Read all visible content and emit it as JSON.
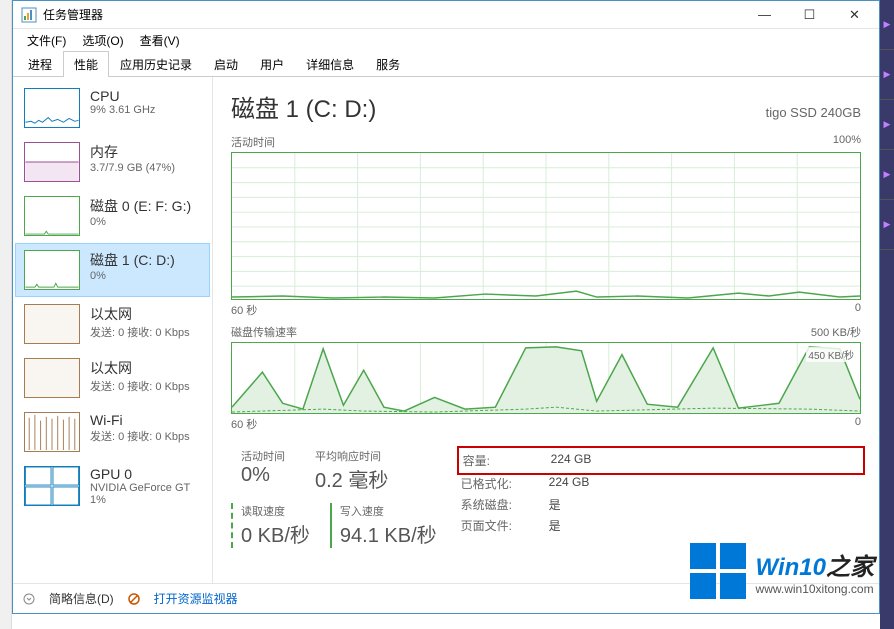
{
  "window": {
    "title": "任务管理器",
    "menu": {
      "file": "文件(F)",
      "options": "选项(O)",
      "view": "查看(V)"
    },
    "tabs": {
      "processes": "进程",
      "performance": "性能",
      "apphistory": "应用历史记录",
      "startup": "启动",
      "users": "用户",
      "details": "详细信息",
      "services": "服务"
    },
    "controls": {
      "min": "—",
      "max": "☐",
      "close": "✕"
    }
  },
  "sidebar": {
    "cpu": {
      "title": "CPU",
      "sub": "9% 3.61 GHz"
    },
    "mem": {
      "title": "内存",
      "sub": "3.7/7.9 GB (47%)"
    },
    "disk0": {
      "title": "磁盘 0 (E: F: G:)",
      "sub": "0%"
    },
    "disk1": {
      "title": "磁盘 1 (C: D:)",
      "sub": "0%"
    },
    "eth0": {
      "title": "以太网",
      "sub": "发送: 0 接收: 0 Kbps"
    },
    "eth1": {
      "title": "以太网",
      "sub": "发送: 0 接收: 0 Kbps"
    },
    "wifi": {
      "title": "Wi-Fi",
      "sub": "发送: 0 接收: 0 Kbps"
    },
    "gpu0": {
      "title": "GPU 0",
      "sub": "NVIDIA GeForce GT",
      "sub2": "1%"
    }
  },
  "main": {
    "title": "磁盘 1 (C: D:)",
    "model": "tigo SSD 240GB",
    "chart1": {
      "label_tl": "活动时间",
      "label_tr": "100%",
      "xl": "60 秒",
      "xr": "0"
    },
    "chart2": {
      "label_tl": "磁盘传输速率",
      "label_tr": "500 KB/秒",
      "inset": "450 KB/秒",
      "xl": "60 秒",
      "xr": "0"
    },
    "stats": {
      "active_label": "活动时间",
      "active_value": "0%",
      "avg_label": "平均响应时间",
      "avg_value": "0.2 毫秒",
      "read_label": "读取速度",
      "read_value": "0 KB/秒",
      "write_label": "写入速度",
      "write_value": "94.1 KB/秒"
    },
    "props": {
      "capacity_k": "容量:",
      "capacity_v": "224 GB",
      "formatted_k": "已格式化:",
      "formatted_v": "224 GB",
      "system_k": "系统磁盘:",
      "system_v": "是",
      "pagefile_k": "页面文件:",
      "pagefile_v": "是"
    }
  },
  "statusbar": {
    "fewer": "简略信息(D)",
    "resmon": "打开资源监视器"
  },
  "watermark": {
    "title_a": "Win10",
    "title_b": "之家",
    "url": "www.win10xitong.com"
  },
  "chart_data": [
    {
      "type": "line",
      "title": "活动时间",
      "xlabel": "秒",
      "ylabel": "%",
      "xlim": [
        0,
        60
      ],
      "ylim": [
        0,
        100
      ],
      "x": [
        60,
        55,
        50,
        45,
        40,
        35,
        30,
        25,
        20,
        15,
        10,
        5,
        0
      ],
      "values": [
        1,
        2,
        0,
        1,
        0,
        3,
        2,
        1,
        4,
        2,
        0,
        2,
        1
      ]
    },
    {
      "type": "line",
      "title": "磁盘传输速率",
      "xlabel": "秒",
      "ylabel": "KB/秒",
      "xlim": [
        0,
        60
      ],
      "ylim": [
        0,
        500
      ],
      "x": [
        60,
        57,
        54,
        51,
        48,
        45,
        42,
        39,
        36,
        33,
        30,
        27,
        24,
        21,
        18,
        15,
        12,
        9,
        6,
        3,
        0
      ],
      "series": [
        {
          "name": "写入",
          "values": [
            30,
            240,
            60,
            20,
            450,
            50,
            300,
            40,
            10,
            90,
            30,
            450,
            470,
            420,
            90,
            400,
            60,
            40,
            450,
            30,
            80
          ]
        },
        {
          "name": "读取",
          "values": [
            5,
            10,
            5,
            0,
            20,
            8,
            15,
            5,
            0,
            6,
            4,
            30,
            25,
            20,
            8,
            15,
            5,
            3,
            20,
            4,
            6
          ]
        }
      ]
    }
  ]
}
